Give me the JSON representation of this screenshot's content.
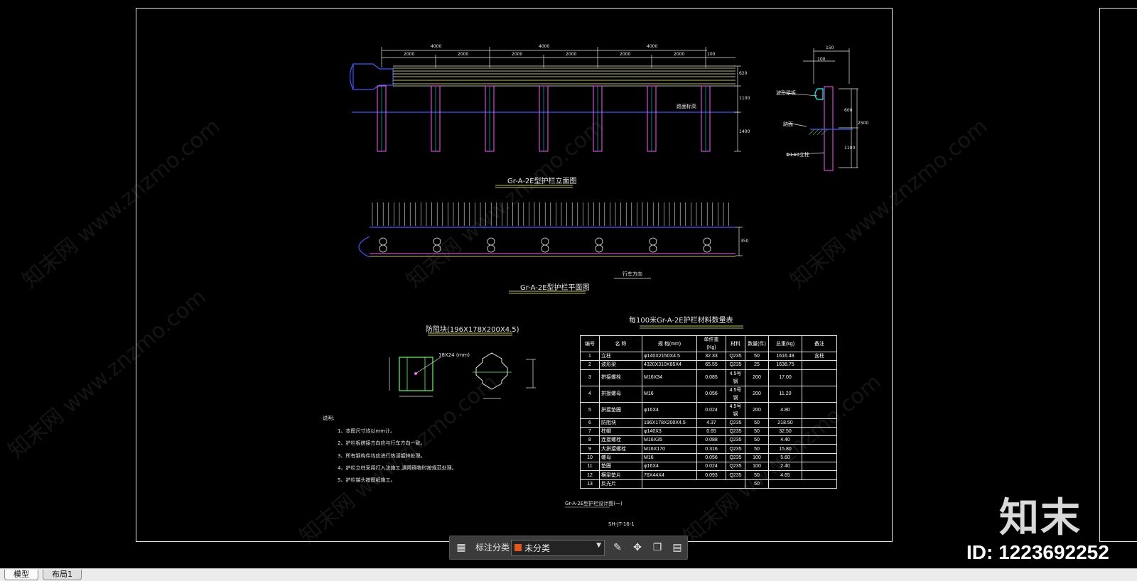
{
  "drawing": {
    "elevation_title": "Gr-A-2E型护栏立面图",
    "plan_title": "Gr-A-2E型护栏平面图",
    "block_title": "防阻块(196X178X200X4.5)",
    "block_dim_label": "18X24 (mm)",
    "table_title": "每100米Gr-A-2E护栏材料数量表",
    "ground_label": "路面标高",
    "traffic_label": "行车方向",
    "sheet_title": "Gr-A-2E型护栏设计图(一)",
    "sheet_no": "SH-JT-16-1",
    "dims_top": [
      "4000",
      "4000",
      "4000",
      "2000",
      "2000",
      "2000",
      "2000",
      "2000",
      "2000",
      "100"
    ],
    "dims_right": [
      "620",
      "1100",
      "1400"
    ],
    "section_dims": [
      "150",
      "100",
      "600",
      "1100",
      "2500"
    ],
    "section_labels": [
      "波形梁板",
      "路面",
      "Φ140立柱"
    ],
    "plan_dim": "350"
  },
  "notes": {
    "heading": "说明:",
    "items": [
      "1、本图尺寸均以mm计。",
      "2、护栏板搭接方向应与行车方向一致。",
      "3、所有钢构件均应进行热浸镀锌处理。",
      "4、护栏立柱采用打入法施工,遇障碍物时按规范处理。",
      "5、护栏端头按图纸施工。"
    ]
  },
  "bom": {
    "headers": [
      "编号",
      "名 称",
      "规 格(mm)",
      "单件重 (Kg)",
      "材料",
      "数量(件)",
      "总重(kg)",
      "备注"
    ],
    "rows": [
      [
        "1",
        "立柱",
        "φ140X2150X4.5",
        "32.33",
        "Q235",
        "50",
        "1616.48",
        "含柱"
      ],
      [
        "2",
        "波形梁",
        "4320X310X85X4",
        "65.55",
        "Q235",
        "25",
        "1638.75",
        ""
      ],
      [
        "3",
        "拼接螺栓",
        "M16X34",
        "0.085",
        "4.5号钢",
        "200",
        "17.00",
        ""
      ],
      [
        "4",
        "拼接螺母",
        "M16",
        "0.056",
        "4.5号钢",
        "200",
        "11.20",
        ""
      ],
      [
        "5",
        "拼接垫圈",
        "φ16X4",
        "0.024",
        "4.5号钢",
        "200",
        "4.80",
        ""
      ],
      [
        "6",
        "防阻块",
        "196X178X200X4.5",
        "4.37",
        "Q235",
        "50",
        "218.50",
        ""
      ],
      [
        "7",
        "柱帽",
        "φ140X3",
        "0.65",
        "Q235",
        "50",
        "32.50",
        ""
      ],
      [
        "8",
        "连接螺栓",
        "M16X35",
        "0.088",
        "Q235",
        "50",
        "4.40",
        ""
      ],
      [
        "9",
        "大拼接螺栓",
        "M16X170",
        "0.316",
        "Q235",
        "50",
        "15.80",
        ""
      ],
      [
        "10",
        "螺母",
        "M16",
        "0.056",
        "Q235",
        "100",
        "5.60",
        ""
      ],
      [
        "11",
        "垫圈",
        "φ16X4",
        "0.024",
        "Q235",
        "100",
        "2.40",
        ""
      ],
      [
        "12",
        "横梁垫片",
        "76X44X4",
        "0.093",
        "Q235",
        "50",
        "4.65",
        ""
      ]
    ],
    "last_row": [
      "13",
      "反光片",
      "50"
    ]
  },
  "toolbar": {
    "label": "标注分类",
    "select_value": "未分类",
    "swatch_color": "#e4571a"
  },
  "tabs": [
    "模型",
    "布局1"
  ],
  "brand": {
    "logo": "知末",
    "id": "ID: 1223692252"
  },
  "watermark": "知末网 www.znzmo.com",
  "colors": {
    "background": "#000000",
    "frame": "#e6e6e6",
    "rail": "#ffff66",
    "post": "#ff55ff",
    "ground": "#3a5bff",
    "cyan": "#00ffff"
  }
}
